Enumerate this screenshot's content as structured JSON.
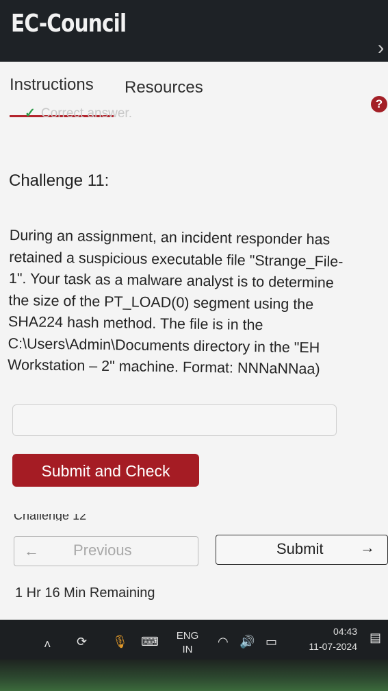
{
  "app": {
    "brand": "EC-Council",
    "close_glyph": "›"
  },
  "tabs": [
    {
      "label": "Instructions",
      "active": true
    },
    {
      "label": "Resources",
      "active": false
    }
  ],
  "help": {
    "glyph": "?"
  },
  "status": {
    "check_glyph": "✓",
    "text": "Correct answer."
  },
  "challenge": {
    "title": "Challenge 11:",
    "lines": [
      "During an assignment, an incident responder has",
      "retained a suspicious executable file \"Strange_File-",
      "1\". Your task as a malware analyst is to determine",
      "the size of the PT_LOAD(0) segment using the",
      "SHA224 hash method. The file is in the",
      "C:\\Users\\Admin\\Documents directory in the \"EH",
      "Workstation – 2\" machine. Format: NNNaNNaa)"
    ]
  },
  "answer": {
    "value": "",
    "placeholder": ""
  },
  "buttons": {
    "submit_check": "Submit and Check",
    "previous": "Previous",
    "previous_arrow": "←",
    "submit": "Submit",
    "submit_arrow": "→"
  },
  "next_challenge_peek": "Challenge 12",
  "timer": "1 Hr 16 Min Remaining",
  "taskbar": {
    "icons": [
      "chevron-up-icon",
      "sync-icon",
      "microphone-icon",
      "keyboard-icon",
      "wifi-icon",
      "speaker-icon",
      "battery-icon",
      "notification-icon"
    ],
    "language_line1": "ENG",
    "language_line2": "IN",
    "time": "04:43",
    "date": "11-07-2024"
  },
  "colors": {
    "accent": "#a51c24",
    "success": "#2f9a4a",
    "panel_bg": "#f4f4f4",
    "topbar_bg": "#1e2226"
  }
}
